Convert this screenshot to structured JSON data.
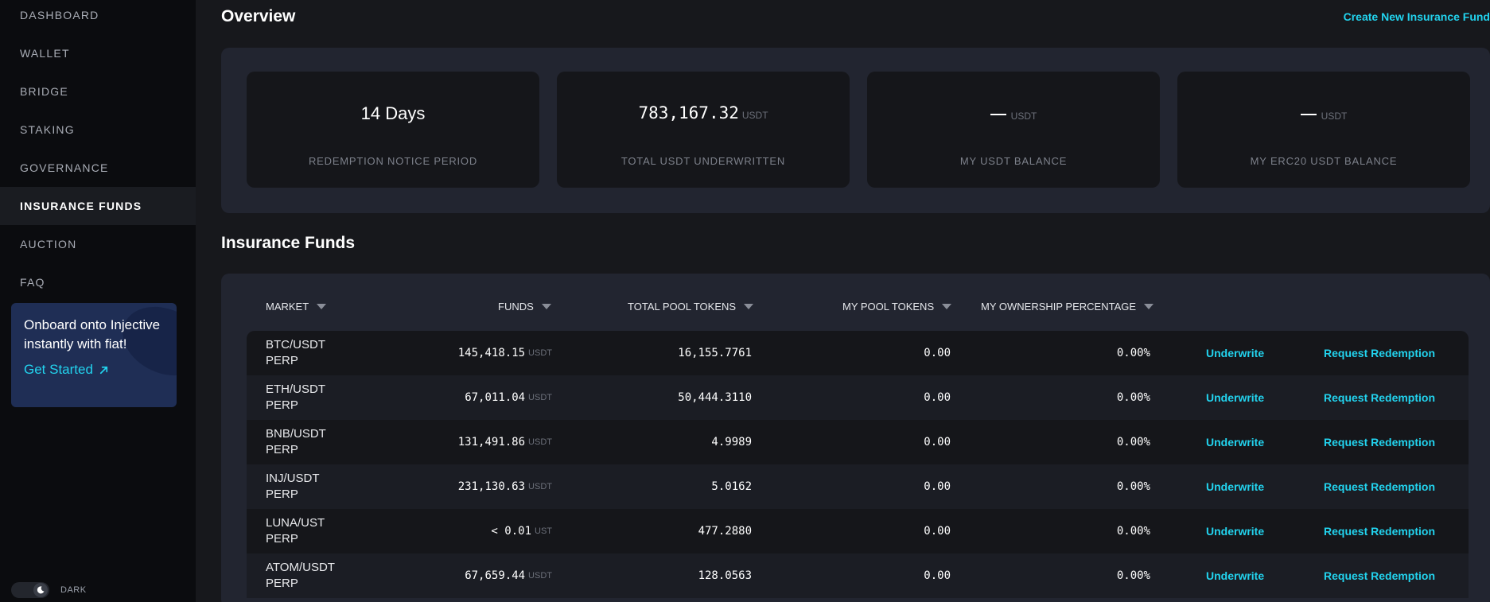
{
  "sidebar": {
    "items": [
      {
        "label": "DASHBOARD",
        "active": false
      },
      {
        "label": "WALLET",
        "active": false
      },
      {
        "label": "BRIDGE",
        "active": false
      },
      {
        "label": "STAKING",
        "active": false
      },
      {
        "label": "GOVERNANCE",
        "active": false
      },
      {
        "label": "INSURANCE FUNDS",
        "active": true
      },
      {
        "label": "AUCTION",
        "active": false
      },
      {
        "label": "FAQ",
        "active": false
      }
    ],
    "onboard": {
      "text": "Onboard onto Injective instantly with fiat!",
      "link": "Get Started"
    },
    "theme_label": "DARK"
  },
  "overview": {
    "title": "Overview",
    "create_link": "Create New Insurance Fund",
    "stats": [
      {
        "value": "14 Days",
        "unit": "",
        "label": "REDEMPTION NOTICE PERIOD"
      },
      {
        "value": "783,167.32",
        "unit": "USDT",
        "label": "TOTAL USDT UNDERWRITTEN"
      },
      {
        "value": "",
        "unit": "USDT",
        "label": "MY USDT BALANCE"
      },
      {
        "value": "",
        "unit": "USDT",
        "label": "MY ERC20 USDT BALANCE"
      }
    ]
  },
  "funds": {
    "title": "Insurance Funds",
    "columns": {
      "market": "MARKET",
      "funds": "FUNDS",
      "total_pool": "TOTAL POOL TOKENS",
      "my_pool": "MY POOL TOKENS",
      "ownership": "MY OWNERSHIP PERCENTAGE"
    },
    "underwrite_label": "Underwrite",
    "redeem_label": "Request Redemption",
    "rows": [
      {
        "market_top": "BTC/USDT",
        "market_bottom": "PERP",
        "funds": "145,418.15",
        "unit": "USDT",
        "total_pool": "16,155.7761",
        "my_pool": "0.00",
        "ownership": "0.00%"
      },
      {
        "market_top": "ETH/USDT",
        "market_bottom": "PERP",
        "funds": "67,011.04",
        "unit": "USDT",
        "total_pool": "50,444.3110",
        "my_pool": "0.00",
        "ownership": "0.00%"
      },
      {
        "market_top": "BNB/USDT",
        "market_bottom": "PERP",
        "funds": "131,491.86",
        "unit": "USDT",
        "total_pool": "4.9989",
        "my_pool": "0.00",
        "ownership": "0.00%"
      },
      {
        "market_top": "INJ/USDT",
        "market_bottom": "PERP",
        "funds": "231,130.63",
        "unit": "USDT",
        "total_pool": "5.0162",
        "my_pool": "0.00",
        "ownership": "0.00%"
      },
      {
        "market_top": "LUNA/UST",
        "market_bottom": "PERP",
        "funds": "< 0.01",
        "unit": "UST",
        "total_pool": "477.2880",
        "my_pool": "0.00",
        "ownership": "0.00%"
      },
      {
        "market_top": "ATOM/USDT",
        "market_bottom": "PERP",
        "funds": "67,659.44",
        "unit": "USDT",
        "total_pool": "128.0563",
        "my_pool": "0.00",
        "ownership": "0.00%"
      }
    ]
  }
}
